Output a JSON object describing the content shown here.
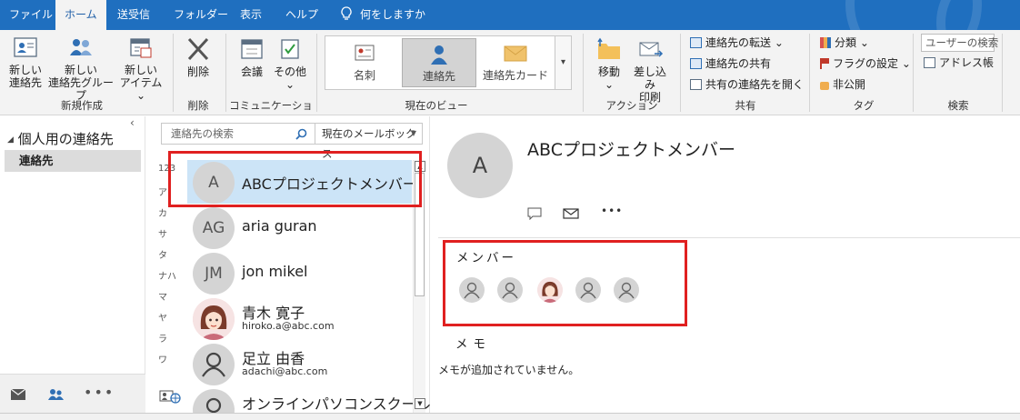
{
  "tabs": [
    "ファイル",
    "ホーム",
    "送受信",
    "フォルダー",
    "表示",
    "ヘルプ"
  ],
  "tell_me": "何をしますか",
  "ribbon": {
    "new_contact": [
      "新しい",
      "連絡先"
    ],
    "new_group": [
      "新しい",
      "連絡先グループ"
    ],
    "new_item": [
      "新しい",
      "アイテム ⌄"
    ],
    "group_new": "新規作成",
    "delete": "削除",
    "group_delete": "削除",
    "meeting": "会議",
    "other": "その他",
    "other_caret": "⌄",
    "group_comm": "コミュニケーション",
    "views": [
      "名刺",
      "連絡先",
      "連絡先カード"
    ],
    "group_view": "現在のビュー",
    "move": "移動",
    "move_caret": "⌄",
    "mail_merge": [
      "差し込み",
      "印刷"
    ],
    "group_actions": "アクション",
    "forward_contact": "連絡先の転送 ⌄",
    "share_contact": "連絡先の共有",
    "open_shared": "共有の連絡先を開く",
    "group_share": "共有",
    "categorize": "分類 ⌄",
    "follow_up": "フラグの設定 ⌄",
    "private": "非公開",
    "group_tags": "タグ",
    "search_people": "ユーザーの検索",
    "address_book": "アドレス帳",
    "group_find": "検索"
  },
  "folder_pane": {
    "header": "個人用の連絡先",
    "item": "連絡先",
    "collapse": "‹"
  },
  "list": {
    "search_placeholder": "連絡先の検索",
    "scope": "現在のメールボックス",
    "index": [
      "123",
      "ア",
      "カ",
      "サ",
      "タ",
      "ナハ",
      "マ",
      "ヤ",
      "ラ",
      "ワ"
    ],
    "contacts": [
      {
        "initials": "A",
        "name": "ABCプロジェクトメンバー",
        "email": ""
      },
      {
        "initials": "AG",
        "name": "aria guran",
        "email": ""
      },
      {
        "initials": "JM",
        "name": "jon mikel",
        "email": ""
      },
      {
        "initials": "",
        "name": "青木 寛子",
        "email": "hiroko.a@abc.com"
      },
      {
        "initials": "",
        "name": "足立 由香",
        "email": "adachi@abc.com"
      },
      {
        "initials": "",
        "name": "オンラインパソコンスクール…",
        "email": ""
      }
    ]
  },
  "reading": {
    "initial": "A",
    "title": "ABCプロジェクトメンバー",
    "members_label": "メンバー",
    "memo_label": "メモ",
    "memo_text": "メモが追加されていません。"
  },
  "colors": {
    "accent": "#1f6fbf",
    "highlight": "#e02020",
    "selection": "#cce4f7"
  }
}
